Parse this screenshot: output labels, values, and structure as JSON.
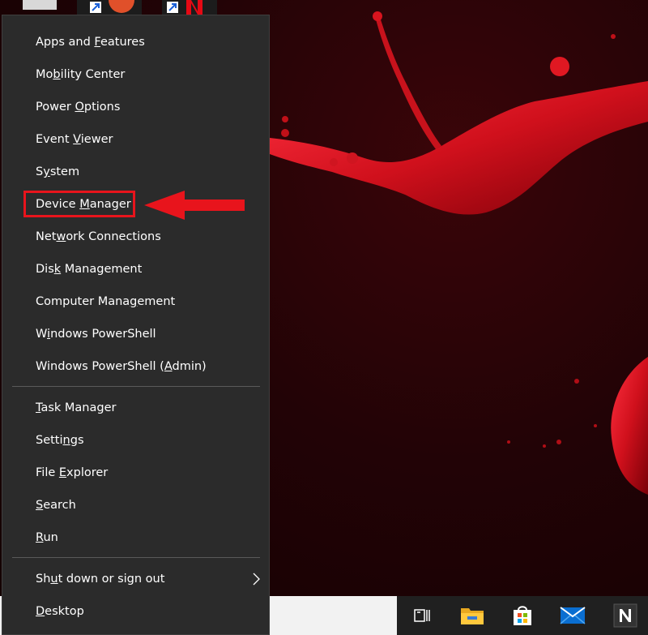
{
  "menu": {
    "groups": [
      [
        {
          "pre": "Apps and ",
          "key": "F",
          "post": "eatures"
        },
        {
          "pre": "Mo",
          "key": "b",
          "post": "ility Center"
        },
        {
          "pre": "Power ",
          "key": "O",
          "post": "ptions"
        },
        {
          "pre": "Event ",
          "key": "V",
          "post": "iewer"
        },
        {
          "pre": "S",
          "key": "y",
          "post": "stem"
        },
        {
          "pre": "Device ",
          "key": "M",
          "post": "anager"
        },
        {
          "pre": "Net",
          "key": "w",
          "post": "ork Connections"
        },
        {
          "pre": "Dis",
          "key": "k",
          "post": " Management"
        },
        {
          "pre": "Computer Mana",
          "key": "g",
          "post": "ement"
        },
        {
          "pre": "W",
          "key": "i",
          "post": "ndows PowerShell"
        },
        {
          "pre": "Windows PowerShell (",
          "key": "A",
          "post": "dmin)"
        }
      ],
      [
        {
          "pre": "",
          "key": "T",
          "post": "ask Manager"
        },
        {
          "pre": "Setti",
          "key": "n",
          "post": "gs"
        },
        {
          "pre": "File ",
          "key": "E",
          "post": "xplorer"
        },
        {
          "pre": "",
          "key": "S",
          "post": "earch"
        },
        {
          "pre": "",
          "key": "R",
          "post": "un"
        }
      ],
      [
        {
          "pre": "Sh",
          "key": "u",
          "post": "t down or sign out"
        },
        {
          "pre": "",
          "key": "D",
          "post": "esktop"
        }
      ]
    ],
    "highlighted": "Device Manager"
  },
  "taskbar": {
    "icons": [
      "task-view-icon",
      "file-explorer-icon",
      "store-icon",
      "mail-icon",
      "app-n-icon"
    ]
  },
  "colors": {
    "menu_bg": "#2b2b2b",
    "highlight": "#e8141c",
    "taskbar_light": "#f2f2f2",
    "taskbar_dark": "#202020"
  }
}
